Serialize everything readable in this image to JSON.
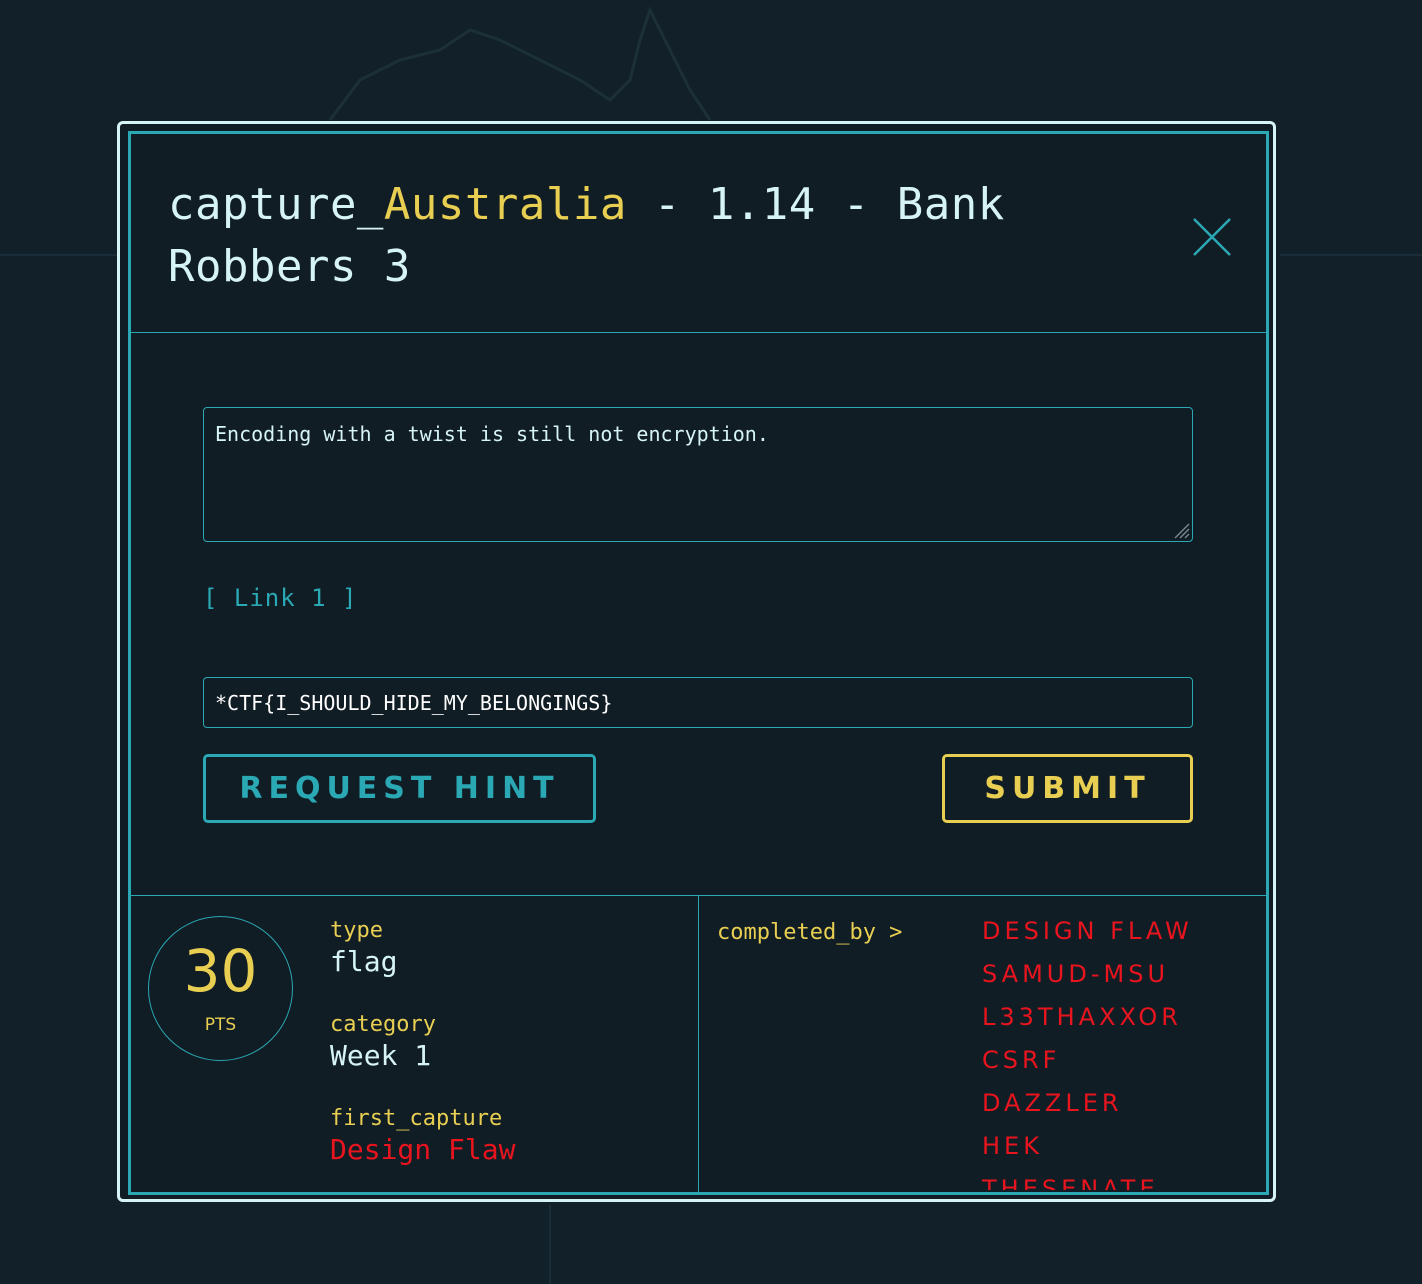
{
  "modal": {
    "title_prefix": "capture_",
    "title_highlight": "Australia",
    "title_suffix": " - 1.14 - Bank Robbers 3",
    "description": "Encoding with a twist is still not encryption.",
    "link_label": "[ Link 1 ]",
    "flag_value": "*CTF{I_SHOULD_HIDE_MY_BELONGINGS}",
    "hint_button": "REQUEST HINT",
    "submit_button": "SUBMIT"
  },
  "footer": {
    "points": "30",
    "points_unit": "PTS",
    "type_label": "type",
    "type_value": "flag",
    "category_label": "category",
    "category_value": "Week 1",
    "first_capture_label": "first_capture",
    "first_capture_value": "Design Flaw",
    "completed_by_label": "completed_by >",
    "completed_by": [
      "DESIGN FLAW",
      "SAMUD-MSU",
      "L33THAXXOR",
      "CSRF",
      "DAZZLER",
      "HEK",
      "THESENATE"
    ]
  },
  "icons": {
    "close": "close-icon",
    "resize": "resize-grip-icon"
  },
  "colors": {
    "background": "#12202a",
    "panel": "#111d25",
    "accent_teal": "#2aa8b4",
    "accent_yellow": "#e8cf52",
    "text_light": "#d6f4f6",
    "red": "#e8141e",
    "outer_border": "#d6f4f6"
  }
}
